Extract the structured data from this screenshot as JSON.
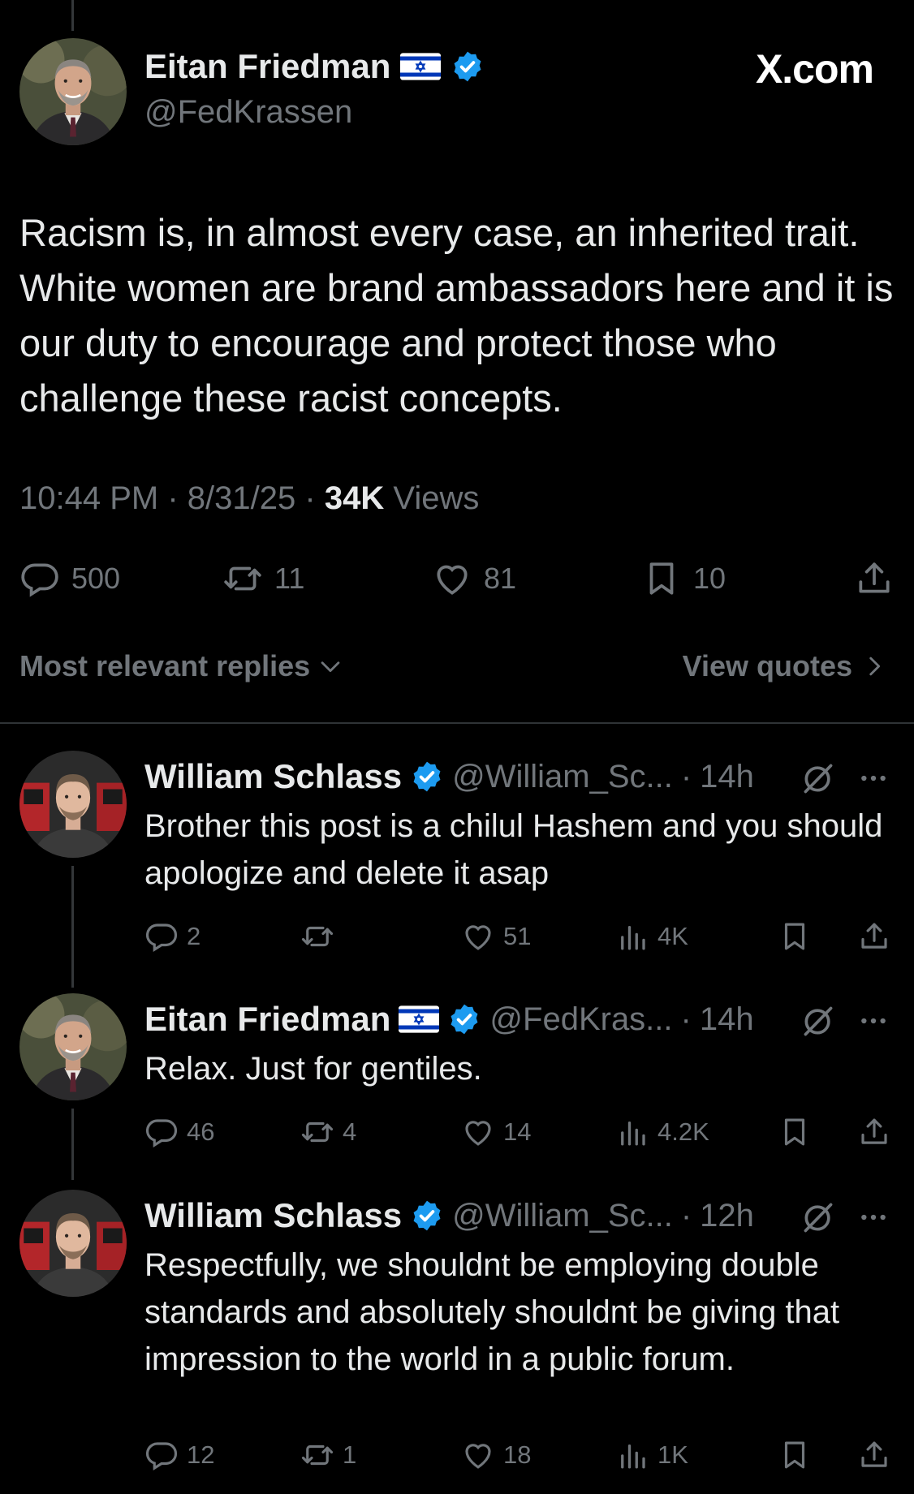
{
  "brand": "X.com",
  "main_tweet": {
    "author_name": "Eitan Friedman",
    "author_handle": "@FedKrassen",
    "text": "Racism is, in almost every case, an inherited trait. White women are brand ambassadors here and it is our duty to encourage and protect those who challenge these racist concepts.",
    "time": "10:44 PM",
    "date": "8/31/25",
    "views_count": "34K",
    "views_label": "Views",
    "replies": "500",
    "reposts": "11",
    "likes": "81",
    "bookmarks": "10"
  },
  "replies_bar": {
    "sort_label": "Most relevant replies",
    "quotes_label": "View quotes"
  },
  "replies": [
    {
      "author_name": "William Schlass",
      "handle": "@William_Sc...",
      "time": "14h",
      "text": "Brother this post is a chilul Hashem and you should apologize and delete it asap",
      "replies": "2",
      "reposts": "",
      "likes": "51",
      "views": "4K"
    },
    {
      "author_name": "Eitan Friedman",
      "handle": "@FedKras...",
      "time": "14h",
      "text": "Relax. Just for gentiles.",
      "replies": "46",
      "reposts": "4",
      "likes": "14",
      "views": "4.2K"
    },
    {
      "author_name": "William Schlass",
      "handle": "@William_Sc...",
      "time": "12h",
      "text": "Respectfully, we shouldnt be employing double standards and absolutely shouldnt be giving that impression to the world in a public forum.",
      "replies": "12",
      "reposts": "1",
      "likes": "18",
      "views": "1K"
    }
  ],
  "separator": "·",
  "colors": {
    "background": "#000000",
    "text": "#e7e9ea",
    "muted": "#71767b",
    "verified": "#1d9bf0",
    "divider": "#2f3336"
  }
}
